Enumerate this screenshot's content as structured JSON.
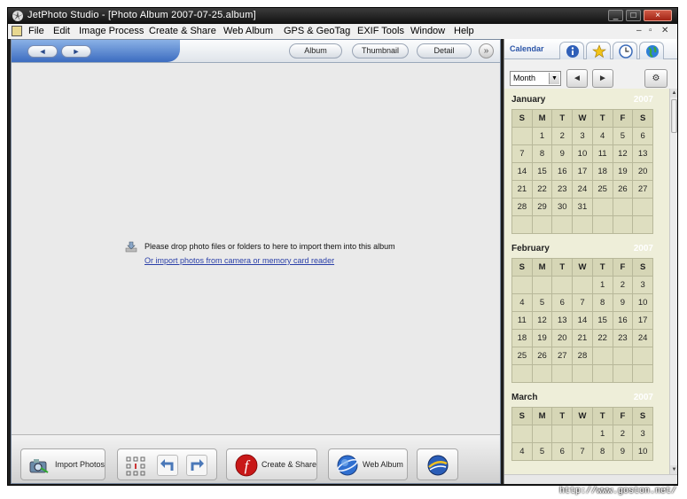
{
  "window": {
    "title": "JetPhoto Studio - [Photo Album 2007-07-25.album]",
    "controls": [
      "_",
      "□",
      "×"
    ]
  },
  "menu": [
    "File",
    "Edit",
    "Image Process",
    "Create & Share",
    "Web Album",
    "GPS & GeoTag",
    "EXIF Tools",
    "Window",
    "Help"
  ],
  "views": {
    "back": "◄",
    "forward": "►",
    "tabs": [
      "Album",
      "Thumbnail",
      "Detail"
    ],
    "more": "»"
  },
  "drop": {
    "message": "Please drop photo files or folders to here to import them into this album",
    "link": "Or import photos from camera or memory card reader"
  },
  "bottom": {
    "import_label": "Import Photos",
    "create_label": "Create & Share",
    "web_label": "Web Album"
  },
  "sidebar": {
    "tab_label": "Calendar",
    "tab_icons": [
      "info-icon",
      "star-icon",
      "clock-icon",
      "globe-icon"
    ],
    "view_select": "Month",
    "prev": "◄",
    "next": "►",
    "settings": "⚙"
  },
  "calendar": {
    "dow": [
      "S",
      "M",
      "T",
      "W",
      "T",
      "F",
      "S"
    ],
    "months": [
      {
        "name": "January",
        "year": "2007",
        "weeks": [
          [
            "",
            "1",
            "2",
            "3",
            "4",
            "5",
            "6"
          ],
          [
            "7",
            "8",
            "9",
            "10",
            "11",
            "12",
            "13"
          ],
          [
            "14",
            "15",
            "16",
            "17",
            "18",
            "19",
            "20"
          ],
          [
            "21",
            "22",
            "23",
            "24",
            "25",
            "26",
            "27"
          ],
          [
            "28",
            "29",
            "30",
            "31",
            "",
            "",
            ""
          ],
          [
            "",
            "",
            "",
            "",
            "",
            "",
            ""
          ]
        ]
      },
      {
        "name": "February",
        "year": "2007",
        "weeks": [
          [
            "",
            "",
            "",
            "",
            "1",
            "2",
            "3"
          ],
          [
            "4",
            "5",
            "6",
            "7",
            "8",
            "9",
            "10"
          ],
          [
            "11",
            "12",
            "13",
            "14",
            "15",
            "16",
            "17"
          ],
          [
            "18",
            "19",
            "20",
            "21",
            "22",
            "23",
            "24"
          ],
          [
            "25",
            "26",
            "27",
            "28",
            "",
            "",
            ""
          ],
          [
            "",
            "",
            "",
            "",
            "",
            "",
            ""
          ]
        ]
      },
      {
        "name": "March",
        "year": "2007",
        "weeks": [
          [
            "",
            "",
            "",
            "",
            "1",
            "2",
            "3"
          ],
          [
            "4",
            "5",
            "6",
            "7",
            "8",
            "9",
            "10"
          ]
        ]
      }
    ]
  },
  "watermark": "http://www.goston.net/"
}
